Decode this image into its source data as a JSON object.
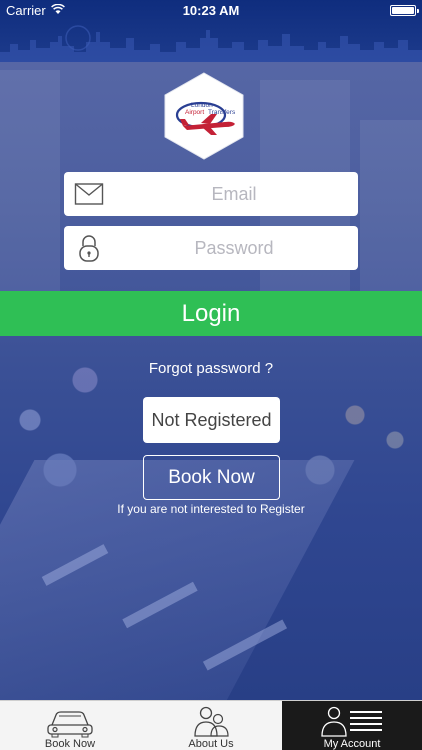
{
  "status_bar": {
    "carrier": "Carrier",
    "time": "10:23 AM"
  },
  "logo": {
    "line1": "London",
    "line2a": "Airport",
    "line2b": "Transfers",
    "icon": "airplane-icon"
  },
  "email": {
    "placeholder": "Email",
    "icon": "envelope-icon"
  },
  "password": {
    "placeholder": "Password",
    "icon": "padlock-icon"
  },
  "login_label": "Login",
  "forgot_label": "Forgot password ?",
  "not_registered_label": "Not Registered",
  "book_now_label": "Book Now",
  "register_hint": "If you are not interested to Register",
  "tabs": [
    {
      "label": "Book Now",
      "icon": "car-icon",
      "active": false
    },
    {
      "label": "About Us",
      "icon": "people-icon",
      "active": false
    },
    {
      "label": "My Account",
      "icon": "account-icon",
      "active": true
    }
  ],
  "colors": {
    "login_green": "#2fbf55",
    "status_blue": "#1d3b8c",
    "logo_red": "#c42136",
    "tab_active": "#1a1a1a"
  }
}
